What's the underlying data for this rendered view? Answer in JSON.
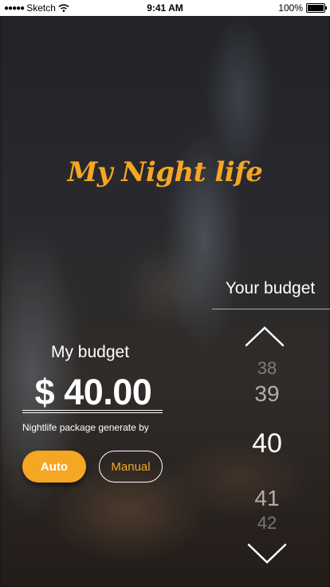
{
  "status_bar": {
    "carrier": "Sketch",
    "time": "9:41 AM",
    "battery": "100%"
  },
  "app": {
    "title": "My Night life"
  },
  "budget_picker": {
    "header": "Your budget",
    "values": [
      "38",
      "39",
      "40",
      "41",
      "42"
    ],
    "selected": "40"
  },
  "budget": {
    "label": "My budget",
    "amount": "$ 40.00",
    "caption": "Nightlife package generate by"
  },
  "buttons": {
    "auto": "Auto",
    "manual": "Manual"
  },
  "colors": {
    "accent": "#f5a623"
  },
  "icons": {
    "picker_up": "chevron-up-icon",
    "picker_down": "chevron-down-icon"
  }
}
